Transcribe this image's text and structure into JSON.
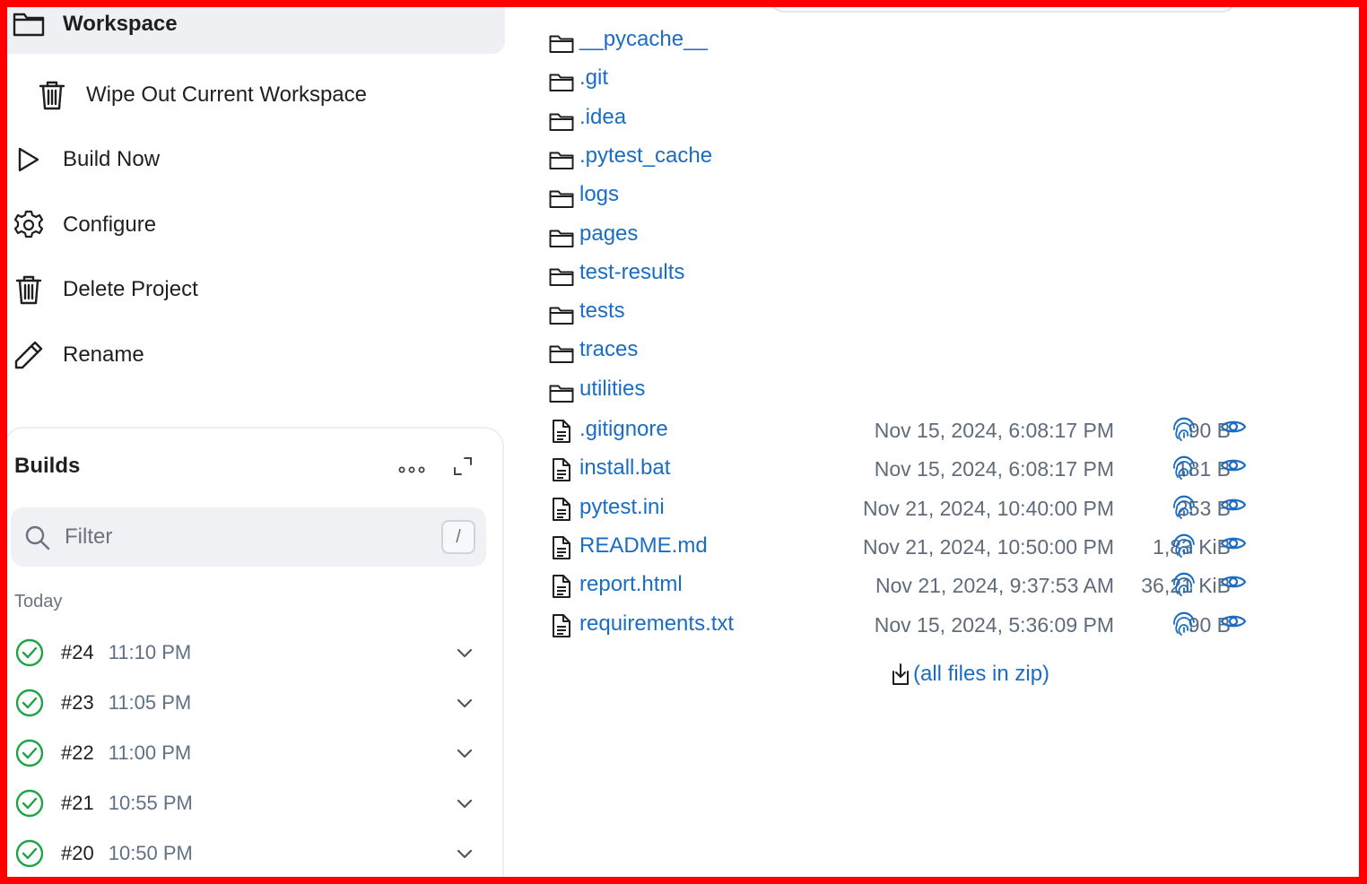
{
  "sidebar": {
    "tasks": {
      "workspace": "Workspace",
      "wipe": "Wipe Out Current Workspace",
      "build_now": "Build Now",
      "configure": "Configure",
      "delete_project": "Delete Project",
      "rename": "Rename"
    },
    "builds": {
      "title": "Builds",
      "filter_placeholder": "Filter",
      "filter_shortcut": "/",
      "group_label": "Today",
      "items": [
        {
          "number": "#24",
          "time": "11:10 PM",
          "status": "success"
        },
        {
          "number": "#23",
          "time": "11:05 PM",
          "status": "success"
        },
        {
          "number": "#22",
          "time": "11:00 PM",
          "status": "success"
        },
        {
          "number": "#21",
          "time": "10:55 PM",
          "status": "success"
        },
        {
          "number": "#20",
          "time": "10:50 PM",
          "status": "success"
        }
      ]
    }
  },
  "workspace": {
    "folders": [
      "__pycache__",
      ".git",
      ".idea",
      ".pytest_cache",
      "logs",
      "pages",
      "test-results",
      "tests",
      "traces",
      "utilities"
    ],
    "files": [
      {
        "name": ".gitignore",
        "date": "Nov 15, 2024, 6:08:17 PM",
        "size": "90 B"
      },
      {
        "name": "install.bat",
        "date": "Nov 15, 2024, 6:08:17 PM",
        "size": "181 B"
      },
      {
        "name": "pytest.ini",
        "date": "Nov 21, 2024, 10:40:00 PM",
        "size": "253 B"
      },
      {
        "name": "README.md",
        "date": "Nov 21, 2024, 10:50:00 PM",
        "size": "1,83 KiB"
      },
      {
        "name": "report.html",
        "date": "Nov 21, 2024, 9:37:53 AM",
        "size": "36,21 KiB"
      },
      {
        "name": "requirements.txt",
        "date": "Nov 15, 2024, 5:36:09 PM",
        "size": "90 B"
      }
    ],
    "zip_link": "(all files in zip)"
  },
  "colors": {
    "link": "#1a6dc2",
    "success": "#1ea446",
    "frame": "#ff0000",
    "muted": "#5f6b7a"
  },
  "icons": {
    "folder": "folder-icon",
    "file": "file-icon",
    "fingerprint": "fingerprint-icon",
    "view": "eye-icon",
    "download": "download-icon"
  }
}
